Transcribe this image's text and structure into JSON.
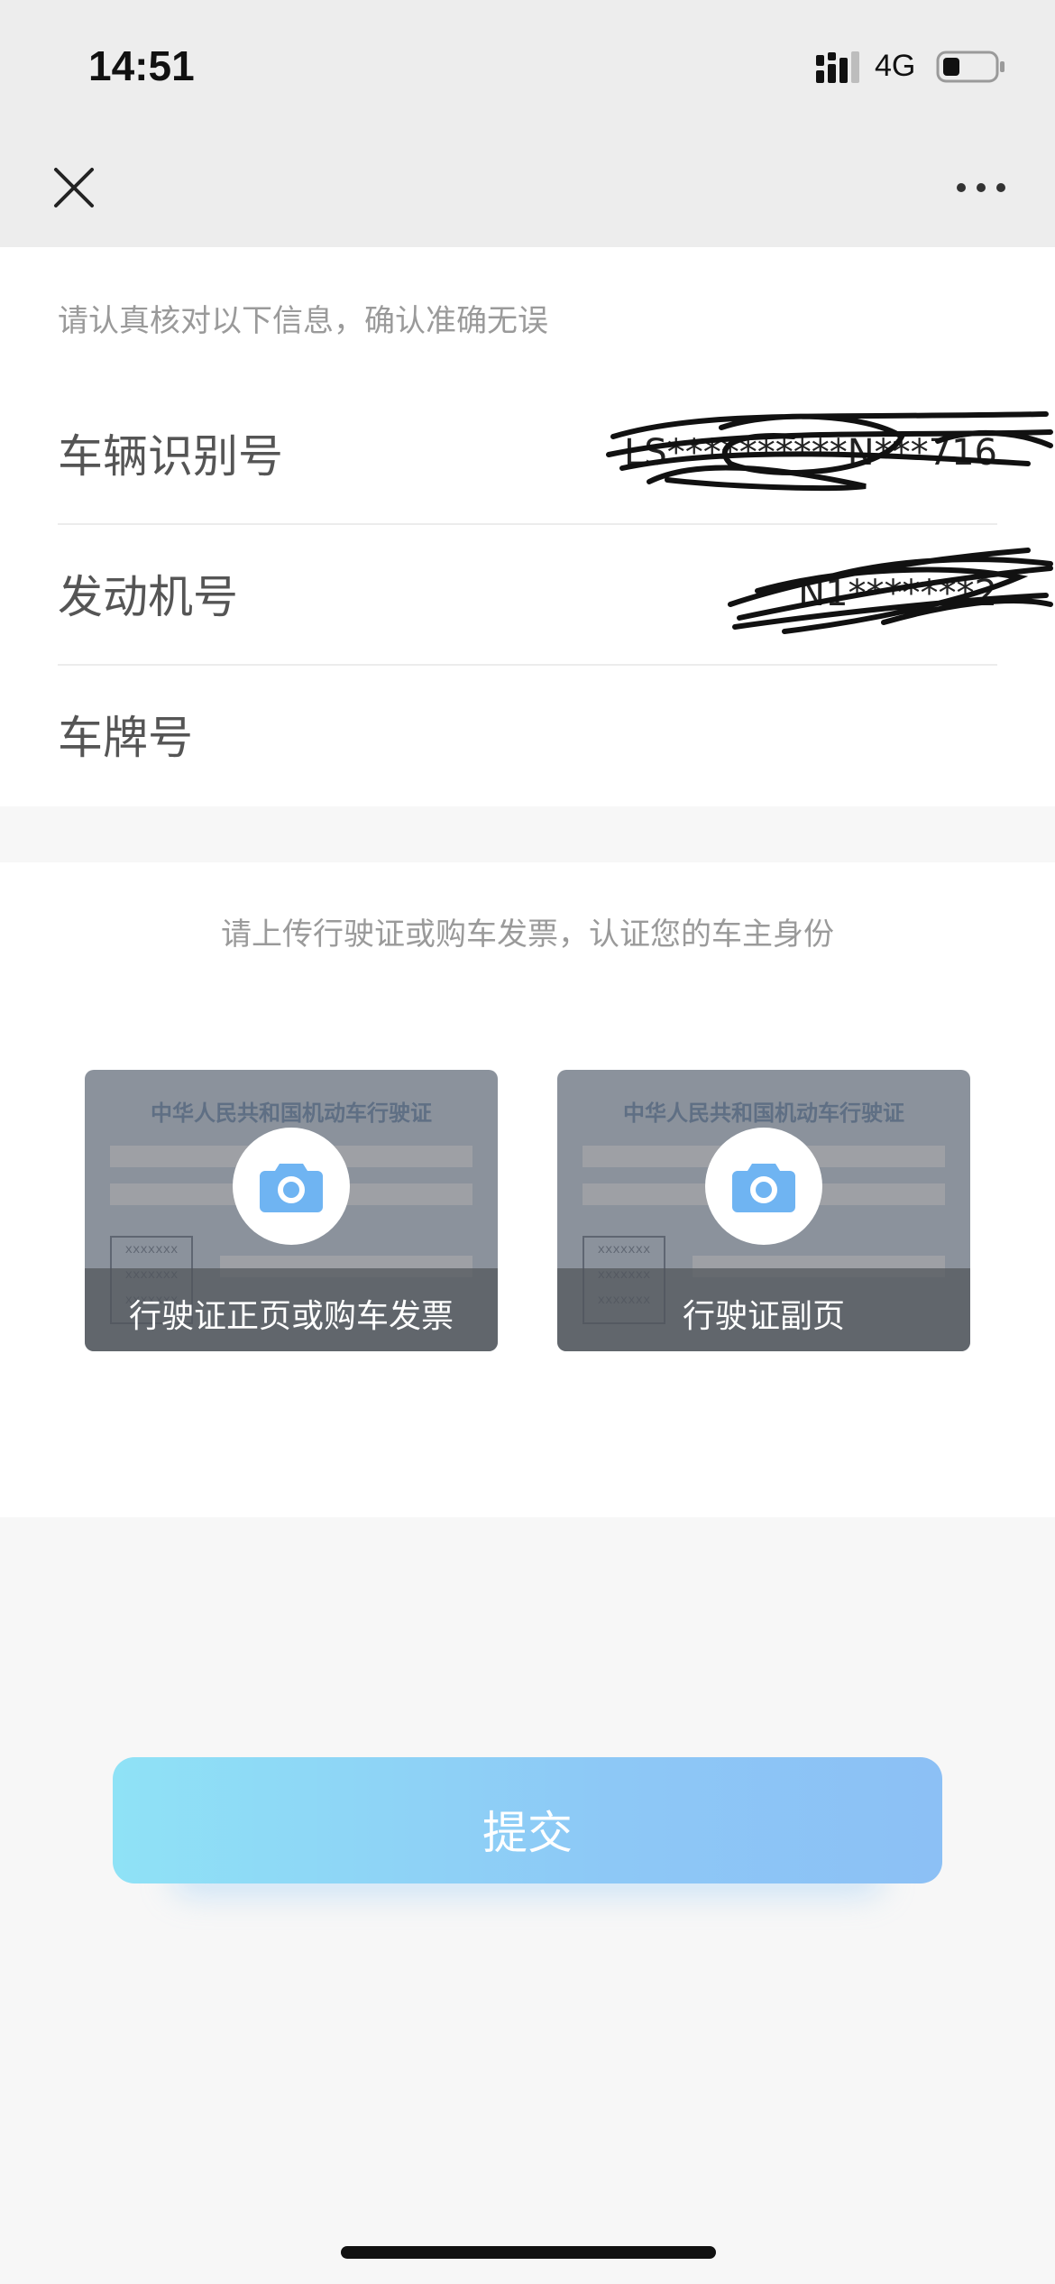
{
  "status_bar": {
    "time": "14:51",
    "network": "4G"
  },
  "nav": {
    "close_icon": "close-icon",
    "more_icon": "more-horizontal-icon"
  },
  "vehicle_info": {
    "hint": "请认真核对以下信息，确认准确无误",
    "fields": [
      {
        "label": "车辆识别号",
        "value": "LS**********N***716"
      },
      {
        "label": "发动机号",
        "value": "N1*******2"
      },
      {
        "label": "车牌号",
        "value": ""
      }
    ]
  },
  "upload": {
    "hint": "请上传行驶证或购车发票，认证您的车主身份",
    "cards": [
      {
        "card_title": "中华人民共和国机动车行驶证",
        "stamp_lines": [
          "xxxxxxx",
          "xxxxxxx",
          "xxxxxxx"
        ],
        "caption": "行驶证正页或购车发票",
        "icon": "camera-icon"
      },
      {
        "card_title": "中华人民共和国机动车行驶证",
        "stamp_lines": [
          "xxxxxxx",
          "xxxxxxx",
          "xxxxxxx"
        ],
        "caption": "行驶证副页",
        "icon": "camera-icon"
      }
    ]
  },
  "submit": {
    "label": "提交"
  },
  "colors": {
    "accent_blue": "#6fb4f2",
    "button_gradient_start": "#8fe2f6",
    "button_gradient_end": "#8cc0f5",
    "header_bg": "#ededed",
    "hint_text": "#9a9a9a"
  }
}
